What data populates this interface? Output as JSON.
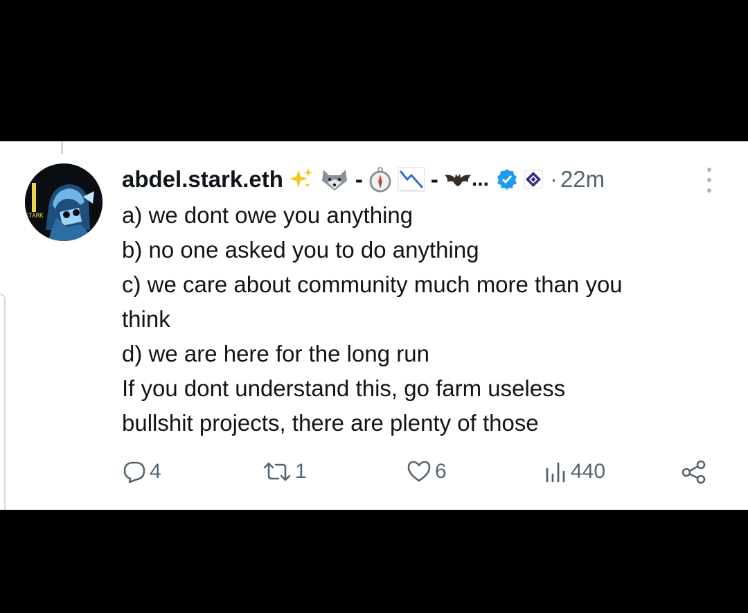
{
  "colors": {
    "background": "#000000",
    "card": "#ffffff",
    "text": "#0f1419",
    "muted": "#536471",
    "verified": "#1d9bf0",
    "affiliate_badge": "#3b2a86"
  },
  "tweet": {
    "display_name": "abdel.stark.eth",
    "name_emojis": [
      "sparkles-icon",
      "wolf-icon",
      "compass-icon",
      "chart-decreasing-icon",
      "bat-icon"
    ],
    "separator_1": "-",
    "separator_2": "-",
    "truncation": "...",
    "time_separator": "·",
    "timestamp": "22m",
    "lines": [
      "a) we dont owe you anything",
      "b) no one asked you to do anything",
      "c) we care about community much more than you",
      "think",
      "d) we are here for the long run",
      "If you dont understand this, go farm useless",
      "bullshit projects, there are plenty of those"
    ],
    "replies": "4",
    "reposts": "1",
    "likes": "6",
    "views": "440",
    "avatar_text": "STARK"
  }
}
